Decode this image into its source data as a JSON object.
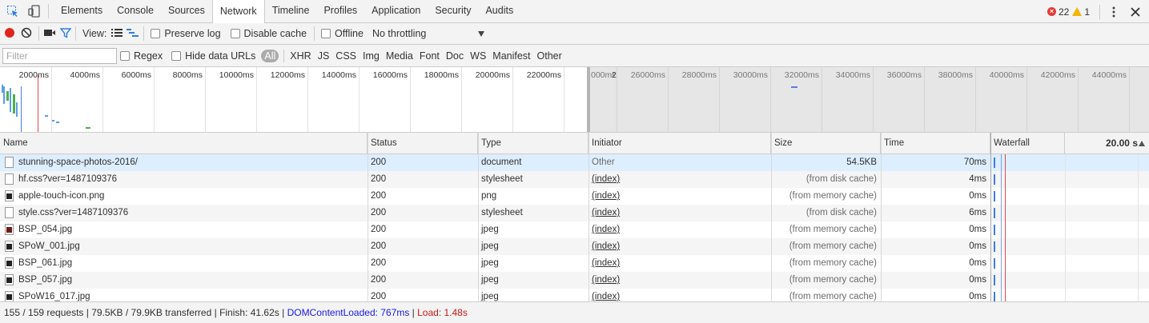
{
  "tabs": [
    "Elements",
    "Console",
    "Sources",
    "Network",
    "Timeline",
    "Profiles",
    "Application",
    "Security",
    "Audits"
  ],
  "active_tab": "Network",
  "errors_count": "22",
  "warnings_count": "1",
  "toolbar": {
    "view_label": "View:",
    "preserve_log": "Preserve log",
    "disable_cache": "Disable cache",
    "offline": "Offline",
    "throttling": "No throttling"
  },
  "filter": {
    "placeholder": "Filter",
    "regex": "Regex",
    "hide_data_urls": "Hide data URLs",
    "types": [
      "All",
      "XHR",
      "JS",
      "CSS",
      "Img",
      "Media",
      "Font",
      "Doc",
      "WS",
      "Manifest",
      "Other"
    ]
  },
  "overview": {
    "left_labels": [
      "2000ms",
      "4000ms",
      "6000ms",
      "8000ms",
      "10000ms",
      "12000ms",
      "14000ms",
      "16000ms",
      "18000ms",
      "20000ms",
      "22000ms",
      "2"
    ],
    "right_labels": [
      "000ms",
      "26000ms",
      "28000ms",
      "30000ms",
      "32000ms",
      "34000ms",
      "36000ms",
      "38000ms",
      "40000ms",
      "42000ms",
      "44000ms",
      "4"
    ]
  },
  "columns": {
    "name": "Name",
    "status": "Status",
    "type": "Type",
    "initiator": "Initiator",
    "size": "Size",
    "time": "Time",
    "waterfall": "Waterfall",
    "waterfall_scale": "20.00 s"
  },
  "requests": [
    {
      "name": "stunning-space-photos-2016/",
      "status": "200",
      "type": "document",
      "initiator": "Other",
      "size": "54.5KB",
      "time": "70ms",
      "icon": "doc"
    },
    {
      "name": "hf.css?ver=1487109376",
      "status": "200",
      "type": "stylesheet",
      "initiator": "(index)",
      "size": "(from disk cache)",
      "time": "4ms",
      "icon": "doc"
    },
    {
      "name": "apple-touch-icon.png",
      "status": "200",
      "type": "png",
      "initiator": "(index)",
      "size": "(from memory cache)",
      "time": "0ms",
      "icon": "img"
    },
    {
      "name": "style.css?ver=1487109376",
      "status": "200",
      "type": "stylesheet",
      "initiator": "(index)",
      "size": "(from disk cache)",
      "time": "6ms",
      "icon": "doc"
    },
    {
      "name": "BSP_054.jpg",
      "status": "200",
      "type": "jpeg",
      "initiator": "(index)",
      "size": "(from memory cache)",
      "time": "0ms",
      "icon": "img-red"
    },
    {
      "name": "SPoW_001.jpg",
      "status": "200",
      "type": "jpeg",
      "initiator": "(index)",
      "size": "(from memory cache)",
      "time": "0ms",
      "icon": "img"
    },
    {
      "name": "BSP_061.jpg",
      "status": "200",
      "type": "jpeg",
      "initiator": "(index)",
      "size": "(from memory cache)",
      "time": "0ms",
      "icon": "img"
    },
    {
      "name": "BSP_057.jpg",
      "status": "200",
      "type": "jpeg",
      "initiator": "(index)",
      "size": "(from memory cache)",
      "time": "0ms",
      "icon": "img"
    },
    {
      "name": "SPoW16_017.jpg",
      "status": "200",
      "type": "jpeg",
      "initiator": "(index)",
      "size": "(from memory cache)",
      "time": "0ms",
      "icon": "img"
    }
  ],
  "status_bar": {
    "summary": "155 / 159 requests | 79.5KB / 79.9KB transferred | Finish: 41.62s | ",
    "dom_content_loaded": "DOMContentLoaded: 767ms",
    "separator": " | ",
    "load": "Load: 1.48s"
  },
  "colors": {
    "record": "#e0261b",
    "filter_active": "#2f7be7",
    "dom_line": "#4a7de2",
    "load_line": "#e04a4a"
  }
}
